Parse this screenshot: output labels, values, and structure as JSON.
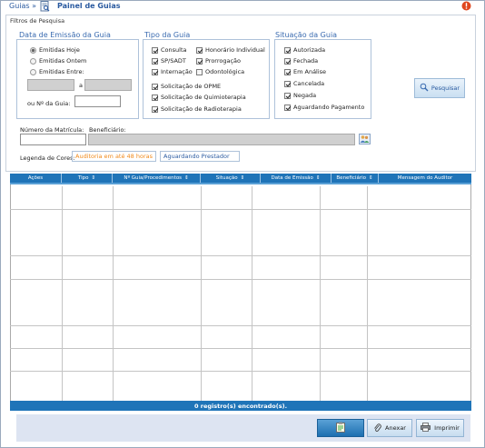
{
  "header": {
    "breadcrumb": "Guias »",
    "title": "Painel de Guias",
    "alert_icon": "alert-icon"
  },
  "filters": {
    "legend": "Filtros de Pesquisa",
    "date_group": {
      "title": "Data de Emissão da Guia",
      "options": [
        {
          "label": "Emitidas Hoje",
          "selected": true
        },
        {
          "label": "Emitidas Ontem",
          "selected": false
        },
        {
          "label": "Emitidas Entre:",
          "selected": false
        }
      ],
      "range_separator": "a",
      "guide_number_label": "ou Nº da Guia:"
    },
    "type_group": {
      "title": "Tipo da Guia",
      "items": [
        {
          "label": "Consulta",
          "checked": true
        },
        {
          "label": "Honorário Individual",
          "checked": true
        },
        {
          "label": "SP/SADT",
          "checked": true
        },
        {
          "label": "Prorrogação",
          "checked": true
        },
        {
          "label": "Internação",
          "checked": true
        },
        {
          "label": "Odontológica",
          "checked": false
        },
        {
          "label": "Solicitação de OPME",
          "checked": true
        },
        {
          "label": "Solicitação de Quimioterapia",
          "checked": true
        },
        {
          "label": "Solicitação de Radioterapia",
          "checked": true
        }
      ]
    },
    "status_group": {
      "title": "Situação da Guia",
      "items": [
        {
          "label": "Autorizada",
          "checked": true
        },
        {
          "label": "Fechada",
          "checked": true
        },
        {
          "label": "Em Análise",
          "checked": true
        },
        {
          "label": "Cancelada",
          "checked": true
        },
        {
          "label": "Negada",
          "checked": true
        },
        {
          "label": "Aguardando Pagamento",
          "checked": true
        }
      ]
    },
    "search_button": "Pesquisar",
    "matricula_label": "Número da Matrícula:",
    "beneficiario_label": "Beneficiário:",
    "legend_colors_label": "Legenda de Cores:",
    "legend_items": [
      {
        "label": "Auditoria em até 48 horas",
        "color": "#f08a1c"
      },
      {
        "label": "Aguardando Prestador",
        "color": "#2a5aa0"
      }
    ]
  },
  "grid": {
    "columns": [
      "Ações",
      "Tipo",
      "Nº Guia/Procedimentos",
      "Situação",
      "Data de Emissão",
      "Beneficiário",
      "Mensagem do Auditor"
    ],
    "sortable": [
      false,
      true,
      true,
      true,
      true,
      true,
      false
    ],
    "footer": "0 registro(s) encontrado(s)."
  },
  "actions": {
    "anexar": "Anexar",
    "imprimir": "Imprimir"
  },
  "colors": {
    "header_blue": "#1f74b8",
    "link_blue": "#2a5aa0",
    "legend_orange": "#f08a1c"
  }
}
